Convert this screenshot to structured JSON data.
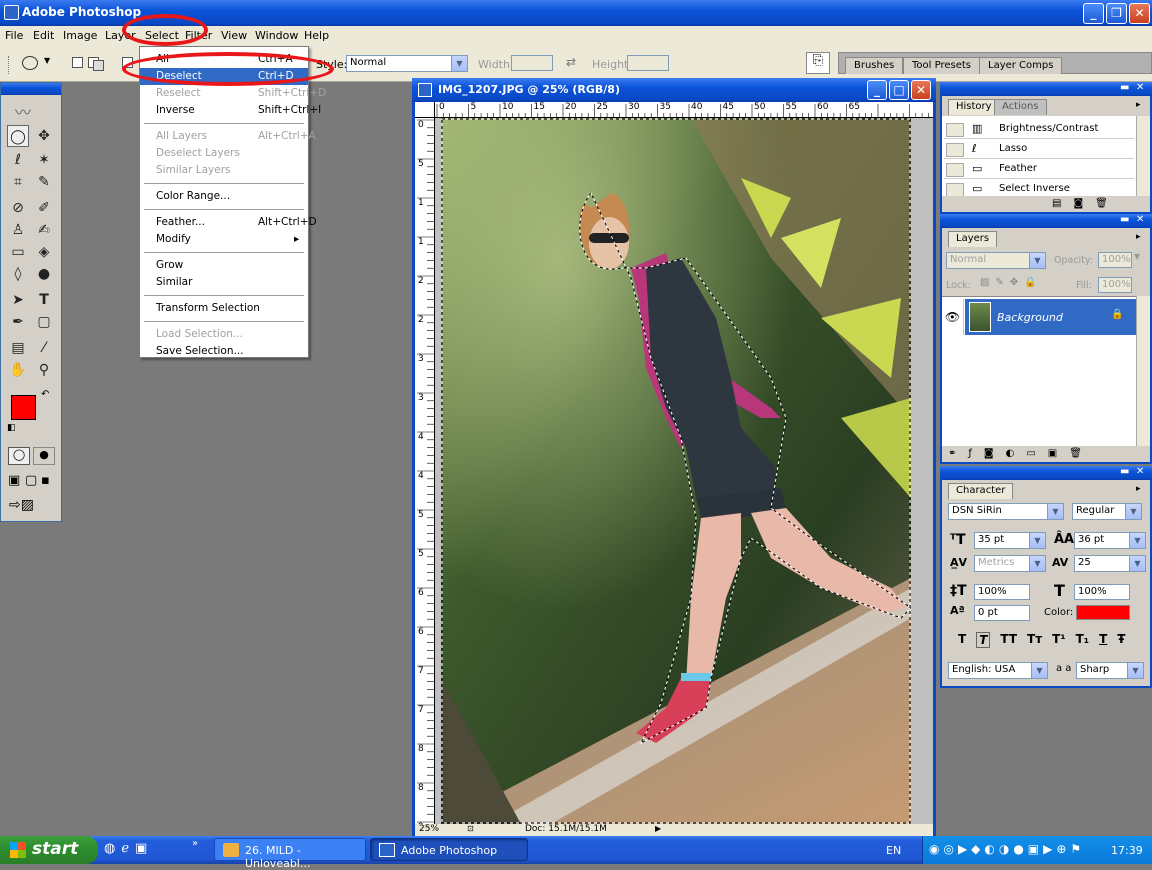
{
  "app": {
    "title": "Adobe Photoshop",
    "window_buttons": [
      "_",
      "❐",
      "✕"
    ]
  },
  "menubar": [
    "File",
    "Edit",
    "Image",
    "Layer",
    "Select",
    "Filter",
    "View",
    "Window",
    "Help"
  ],
  "options_bar": {
    "style_label": "Style:",
    "style_value": "Normal",
    "width_label": "Width:",
    "height_label": "Height:"
  },
  "palette_well": {
    "tabs": [
      "Brushes",
      "Tool Presets",
      "Layer Comps"
    ]
  },
  "select_menu": {
    "items": [
      {
        "label": "All",
        "shortcut": "Ctrl+A",
        "state": "normal"
      },
      {
        "label": "Deselect",
        "shortcut": "Ctrl+D",
        "state": "highlighted"
      },
      {
        "label": "Reselect",
        "shortcut": "Shift+Ctrl+D",
        "state": "disabled"
      },
      {
        "label": "Inverse",
        "shortcut": "Shift+Ctrl+I",
        "state": "normal"
      },
      {
        "label": "All Layers",
        "shortcut": "Alt+Ctrl+A",
        "state": "disabled"
      },
      {
        "label": "Deselect Layers",
        "shortcut": "",
        "state": "disabled"
      },
      {
        "label": "Similar Layers",
        "shortcut": "",
        "state": "disabled"
      },
      {
        "label": "Color Range...",
        "shortcut": "",
        "state": "normal"
      },
      {
        "label": "Feather...",
        "shortcut": "Alt+Ctrl+D",
        "state": "normal"
      },
      {
        "label": "Modify",
        "shortcut": "",
        "state": "submenu"
      },
      {
        "label": "Grow",
        "shortcut": "",
        "state": "normal"
      },
      {
        "label": "Similar",
        "shortcut": "",
        "state": "normal"
      },
      {
        "label": "Transform Selection",
        "shortcut": "",
        "state": "normal"
      },
      {
        "label": "Load Selection...",
        "shortcut": "",
        "state": "disabled"
      },
      {
        "label": "Save Selection...",
        "shortcut": "",
        "state": "normal"
      }
    ]
  },
  "document": {
    "title": "IMG_1207.JPG @ 25% (RGB/8)",
    "ruler_h": [
      "0",
      "5",
      "10",
      "15",
      "20",
      "25",
      "30",
      "35",
      "40",
      "45",
      "50",
      "55",
      "60",
      "65"
    ],
    "ruler_v": [
      "0",
      "5",
      "1",
      "1",
      "2",
      "2",
      "3",
      "3",
      "4",
      "4",
      "5",
      "5",
      "6",
      "6",
      "7",
      "7",
      "8",
      "8",
      "9",
      "9"
    ],
    "zoom": "25%",
    "doc_size": "Doc: 15.1M/15.1M"
  },
  "history": {
    "tabs": [
      "History",
      "Actions"
    ],
    "items": [
      "Brightness/Contrast",
      "Lasso",
      "Feather",
      "Select Inverse"
    ]
  },
  "layers": {
    "tab": "Layers",
    "blend_mode": "Normal",
    "opacity_label": "Opacity:",
    "opacity": "100%",
    "lock_label": "Lock:",
    "fill_label": "Fill:",
    "fill": "100%",
    "layer_name": "Background"
  },
  "character": {
    "tab": "Character",
    "font": "DSN SiRin",
    "style": "Regular",
    "size": "35 pt",
    "leading": "36 pt",
    "kerning": "Metrics",
    "tracking": "25",
    "vscale": "100%",
    "hscale": "100%",
    "baseline": "0 pt",
    "color_label": "Color:",
    "color": "#ff0000",
    "language": "English: USA",
    "aa_label": "a a",
    "antialias": "Sharp",
    "style_buttons": [
      "T",
      "T",
      "TT",
      "Tт",
      "T¹",
      "T₁",
      "T",
      "Ŧ"
    ]
  },
  "taskbar": {
    "start": "start",
    "tasks": [
      "26. MILD - Unloveabl...",
      "Adobe Photoshop"
    ],
    "lang": "EN",
    "clock": "17:39"
  },
  "colors": {
    "accent": "#0a48c4",
    "foreground": "#ff0000",
    "background": "#a8dcf8",
    "highlight": "#316ac5",
    "annotation": "#e8181a"
  }
}
